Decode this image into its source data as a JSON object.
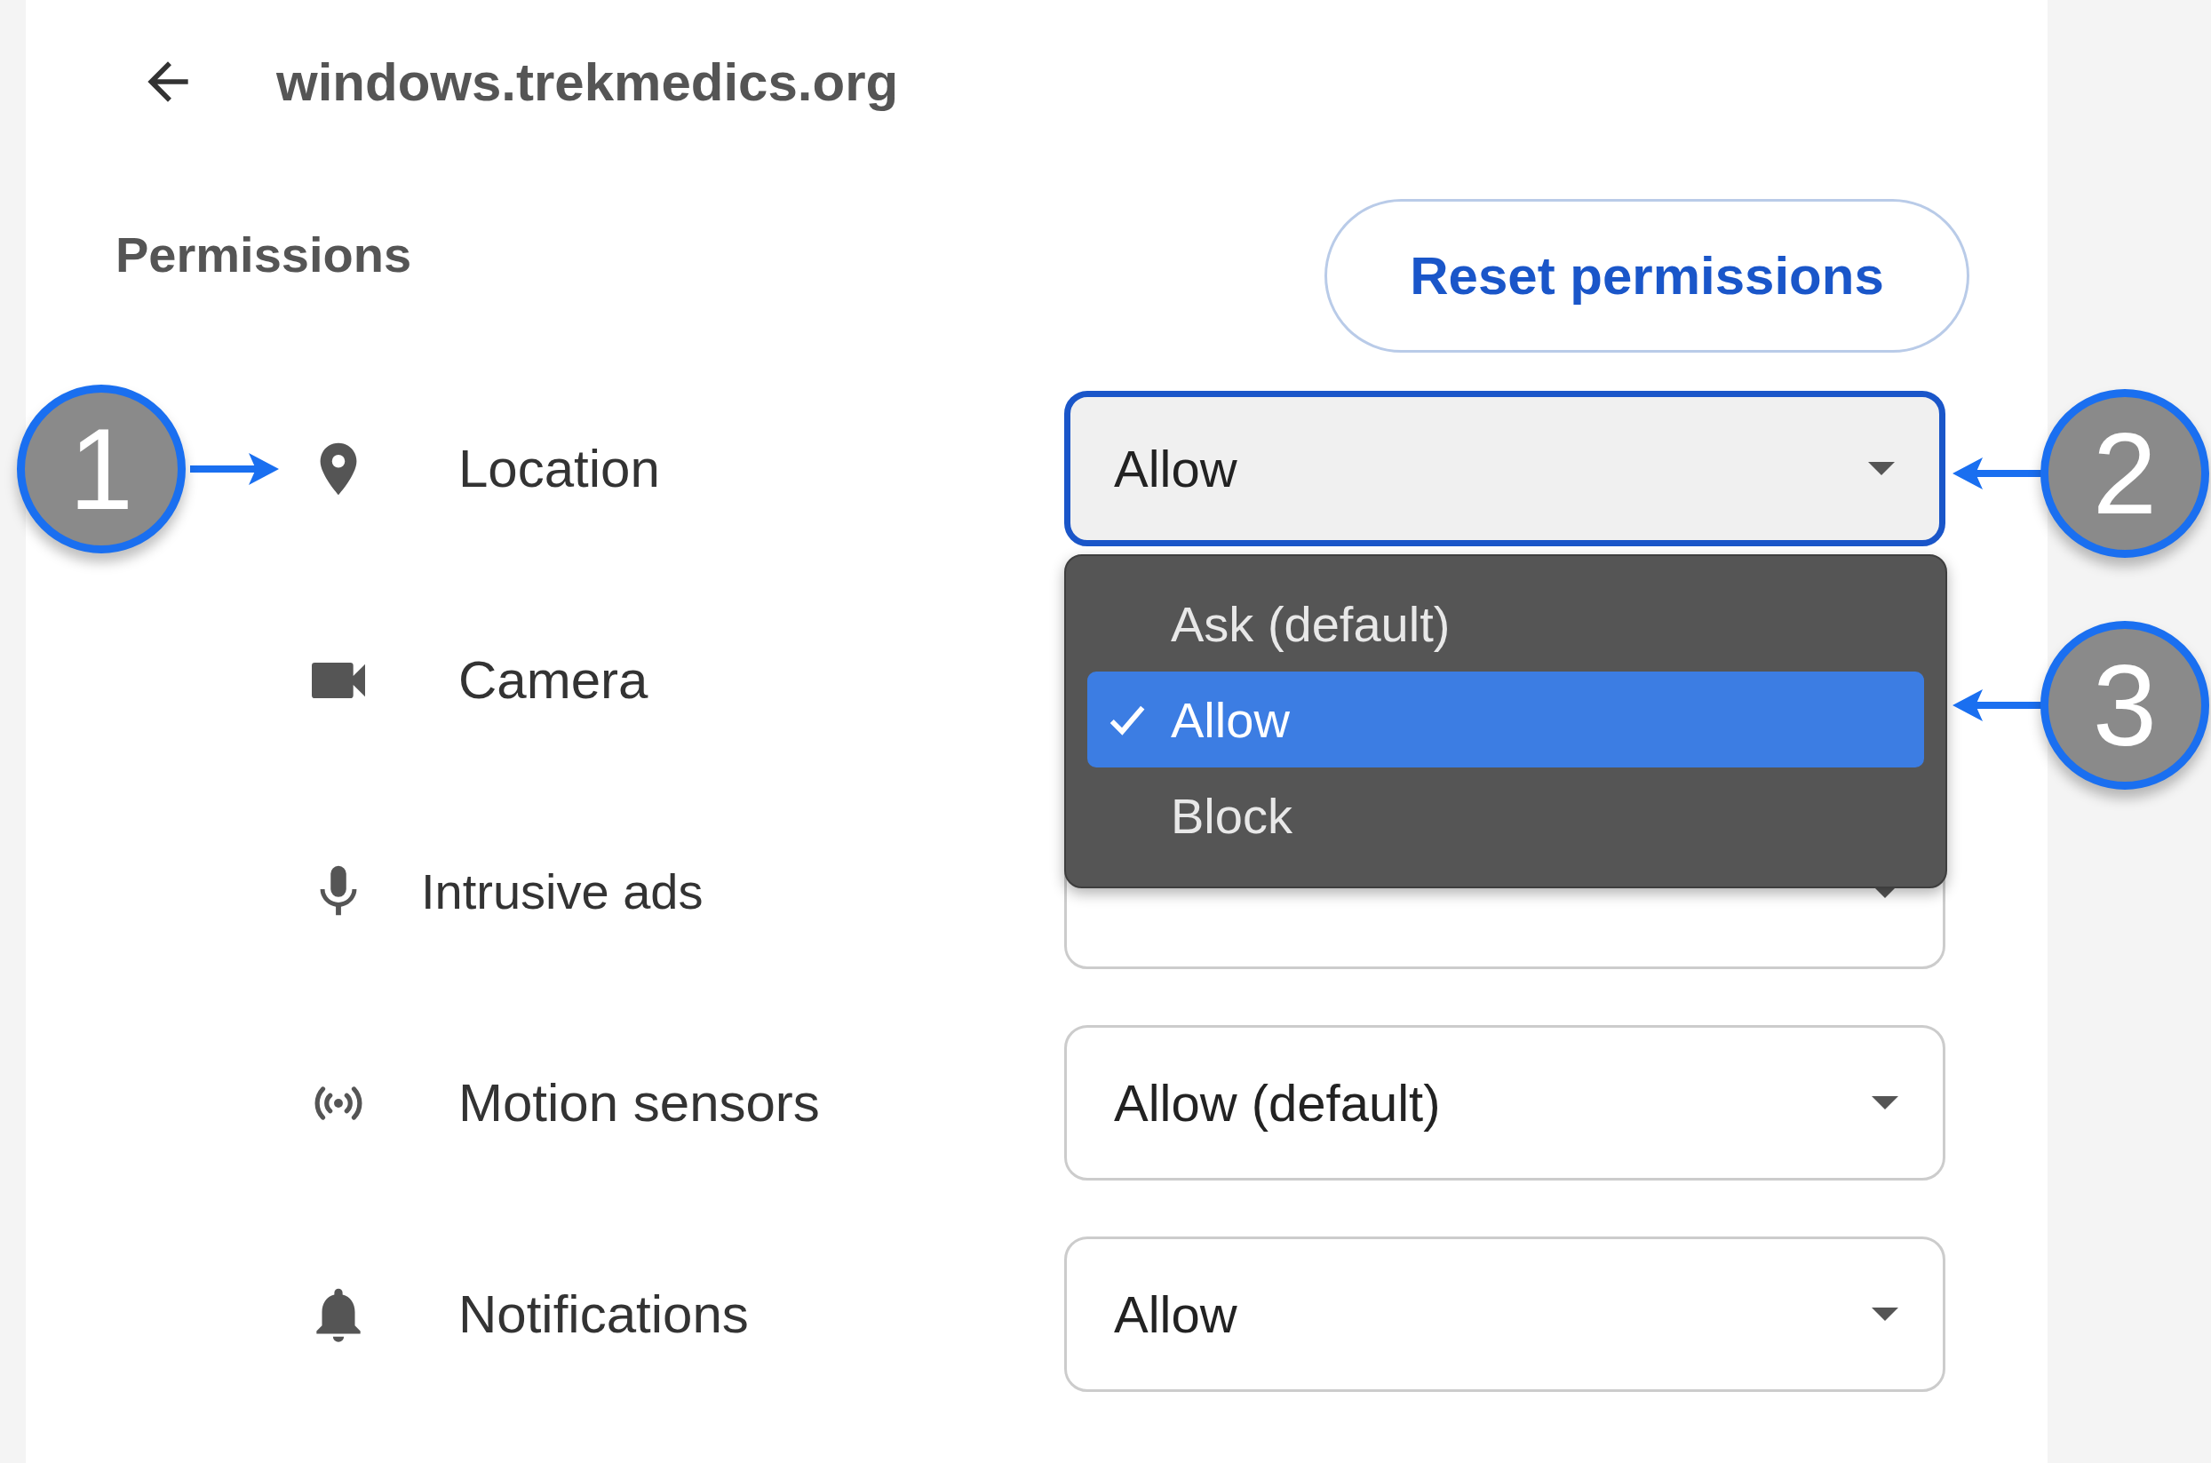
{
  "header": {
    "title": "windows.trekmedics.org"
  },
  "section": {
    "title": "Permissions",
    "reset_button": "Reset permissions"
  },
  "permissions": [
    {
      "kind": "location",
      "label": "Location",
      "value": "Allow",
      "focused": true
    },
    {
      "kind": "camera",
      "label": "Camera"
    },
    {
      "kind": "microphone",
      "label": "Intrusive ads",
      "dropdown_covered": true,
      "focused": false
    },
    {
      "kind": "motion",
      "label": "Motion sensors",
      "value": "Allow (default)",
      "focused": false
    },
    {
      "kind": "notifications",
      "label": "Notifications",
      "value": "Allow",
      "focused": false
    }
  ],
  "menu": {
    "options": [
      {
        "label": "Ask (default)",
        "selected": false
      },
      {
        "label": "Allow",
        "selected": true
      },
      {
        "label": "Block",
        "selected": false
      }
    ]
  },
  "callouts": [
    {
      "number": "1"
    },
    {
      "number": "2"
    },
    {
      "number": "3"
    }
  ]
}
